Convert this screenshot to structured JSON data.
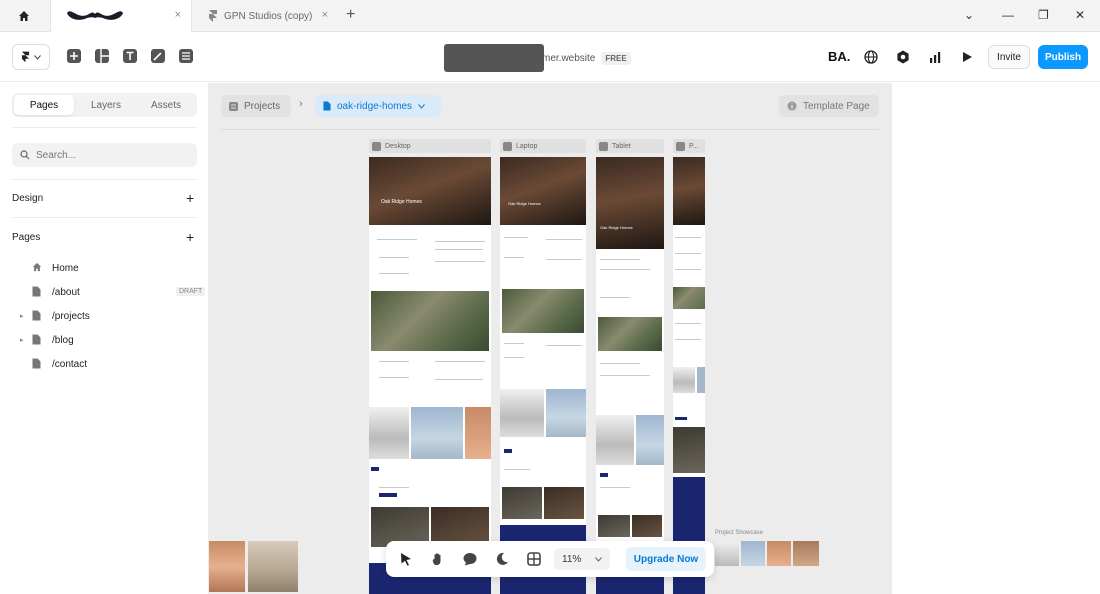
{
  "titlebar": {
    "tabs": [
      {
        "label": ""
      },
      {
        "label": "GPN Studios (copy)"
      }
    ],
    "close_glyph": "×",
    "new_tab_glyph": "+",
    "window_controls": [
      "⌄",
      "—",
      "❐",
      "✕"
    ]
  },
  "toolbar": {
    "domain_suffix": "mer.website",
    "plan_badge": "FREE",
    "avatar_initials": "BA.",
    "invite_label": "Invite",
    "publish_label": "Publish"
  },
  "left_panel": {
    "tabs": [
      "Pages",
      "Layers",
      "Assets"
    ],
    "search_placeholder": "Search...",
    "design_heading": "Design",
    "pages_heading": "Pages",
    "pages": [
      {
        "label": "Home",
        "icon": "home-icon"
      },
      {
        "label": "/about",
        "icon": "page-icon",
        "badge": "DRAFT"
      },
      {
        "label": "/projects",
        "icon": "page-icon",
        "expandable": true
      },
      {
        "label": "/blog",
        "icon": "page-icon",
        "expandable": true
      },
      {
        "label": "/contact",
        "icon": "page-icon"
      }
    ]
  },
  "canvas": {
    "breadcrumb_root": "Projects",
    "breadcrumb_current": "oak-ridge-homes",
    "template_page_label": "Template Page",
    "breakpoints": [
      "Desktop",
      "Laptop",
      "Tablet",
      "P..."
    ],
    "hero_title": "Oak Ridge Homes",
    "project_showcase_label": "Project Showcase"
  },
  "bottom_toolbar": {
    "zoom": "11%",
    "upgrade_label": "Upgrade Now"
  },
  "colors": {
    "accent": "#0b99ff",
    "canvas_bg": "#ececec",
    "navy": "#1a2670"
  }
}
